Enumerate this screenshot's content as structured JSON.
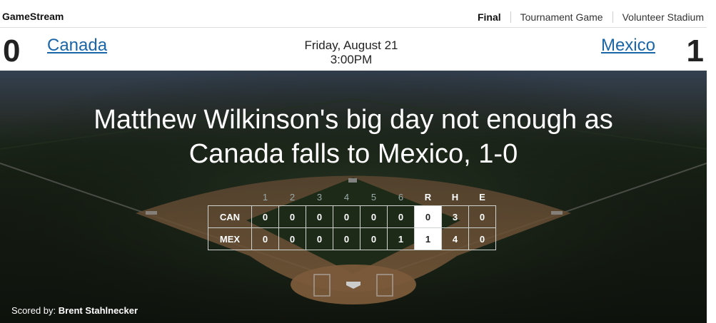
{
  "app": {
    "brand": "GameStream"
  },
  "status": {
    "state": "Final",
    "game_type": "Tournament Game",
    "venue": "Volunteer Stadium"
  },
  "away": {
    "name": "Canada",
    "score": "0",
    "abbr": "CAN"
  },
  "home": {
    "name": "Mexico",
    "score": "1",
    "abbr": "MEX"
  },
  "schedule": {
    "date": "Friday, August 21",
    "time": "3:00PM"
  },
  "headline": {
    "line1": "Matthew Wilkinson's big day not enough as",
    "line2": "Canada falls to Mexico, 1-0"
  },
  "boxscore": {
    "innings": [
      "1",
      "2",
      "3",
      "4",
      "5",
      "6"
    ],
    "totals_labels": [
      "R",
      "H",
      "E"
    ],
    "rows": [
      {
        "team": "CAN",
        "innings": [
          "0",
          "0",
          "0",
          "0",
          "0",
          "0"
        ],
        "R": "0",
        "H": "3",
        "E": "0"
      },
      {
        "team": "MEX",
        "innings": [
          "0",
          "0",
          "0",
          "0",
          "0",
          "1"
        ],
        "R": "1",
        "H": "4",
        "E": "0"
      }
    ]
  },
  "footer": {
    "scored_by_label": "Scored by:",
    "scorer": "Brent Stahlnecker"
  },
  "colors": {
    "link": "#1a66a8",
    "field_dark": "#0e120c",
    "dirt": "#6e5236"
  }
}
